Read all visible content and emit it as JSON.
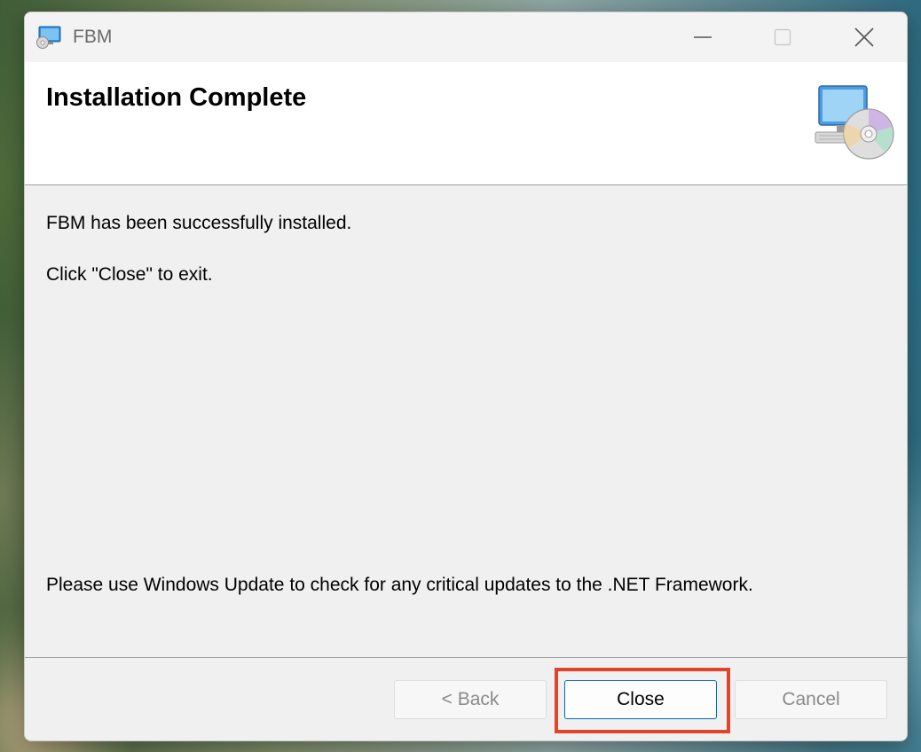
{
  "window": {
    "title": "FBM"
  },
  "icons": {
    "app": "setup-computer-cd-icon",
    "minimize": "minimize-icon",
    "maximize": "maximize-icon",
    "close": "close-icon",
    "header": "computer-with-cd-icon"
  },
  "header": {
    "title": "Installation Complete"
  },
  "content": {
    "message_1": "FBM has been successfully installed.",
    "message_2": "Click \"Close\" to exit.",
    "message_3": "Please use Windows Update to check for any critical updates to the .NET Framework."
  },
  "buttons": {
    "back": "< Back",
    "close": "Close",
    "cancel": "Cancel"
  },
  "colors": {
    "highlight": "#e0442b",
    "accent": "#0067c0"
  }
}
